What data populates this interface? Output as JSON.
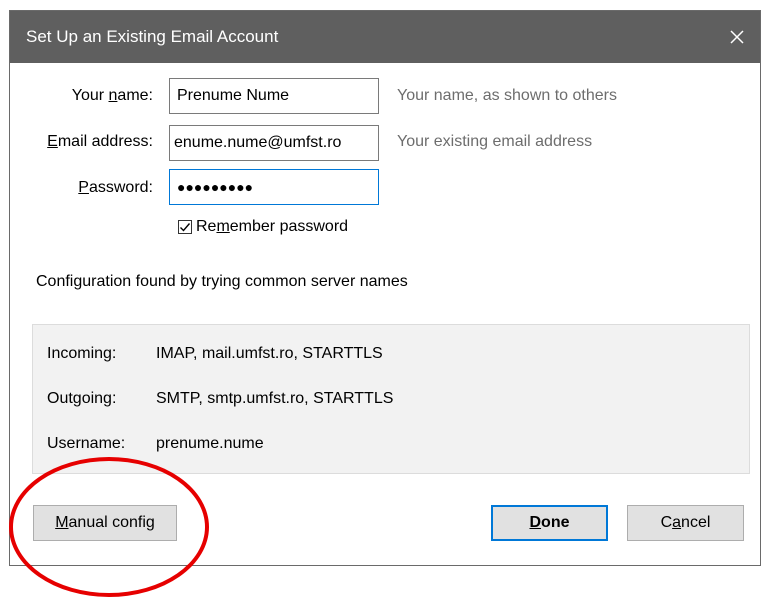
{
  "window": {
    "title": "Set Up an Existing Email Account",
    "close_icon": "close-icon"
  },
  "form": {
    "name_label_pre": "Your ",
    "name_label_ul": "n",
    "name_label_post": "ame:",
    "name_value": "Prenume Nume",
    "name_hint": "Your name, as shown to others",
    "email_label_pre": "",
    "email_label_ul": "E",
    "email_label_post": "mail address:",
    "email_value": "enume.nume@umfst.ro",
    "email_hint": "Your existing email address",
    "password_label_pre": "",
    "password_label_ul": "P",
    "password_label_post": "assword:",
    "password_value": "●●●●●●●●●",
    "remember_pre": "Re",
    "remember_ul": "m",
    "remember_post": "ember password",
    "remember_checked": true
  },
  "status": {
    "message": "Configuration found by trying common server names"
  },
  "config": {
    "incoming_label": "Incoming:",
    "incoming_value": "IMAP, mail.umfst.ro, STARTTLS",
    "outgoing_label": "Outgoing:",
    "outgoing_value": "SMTP, smtp.umfst.ro, STARTTLS",
    "username_label": "Username:",
    "username_value": "prenume.nume"
  },
  "buttons": {
    "manual_ul": "M",
    "manual_post": "anual config",
    "done_ul": "D",
    "done_post": "one",
    "cancel_pre": "C",
    "cancel_ul": "a",
    "cancel_post": "ncel"
  },
  "colors": {
    "titlebar": "#5f5f5f",
    "focus_border": "#0078d7",
    "annotation": "#e60000"
  }
}
